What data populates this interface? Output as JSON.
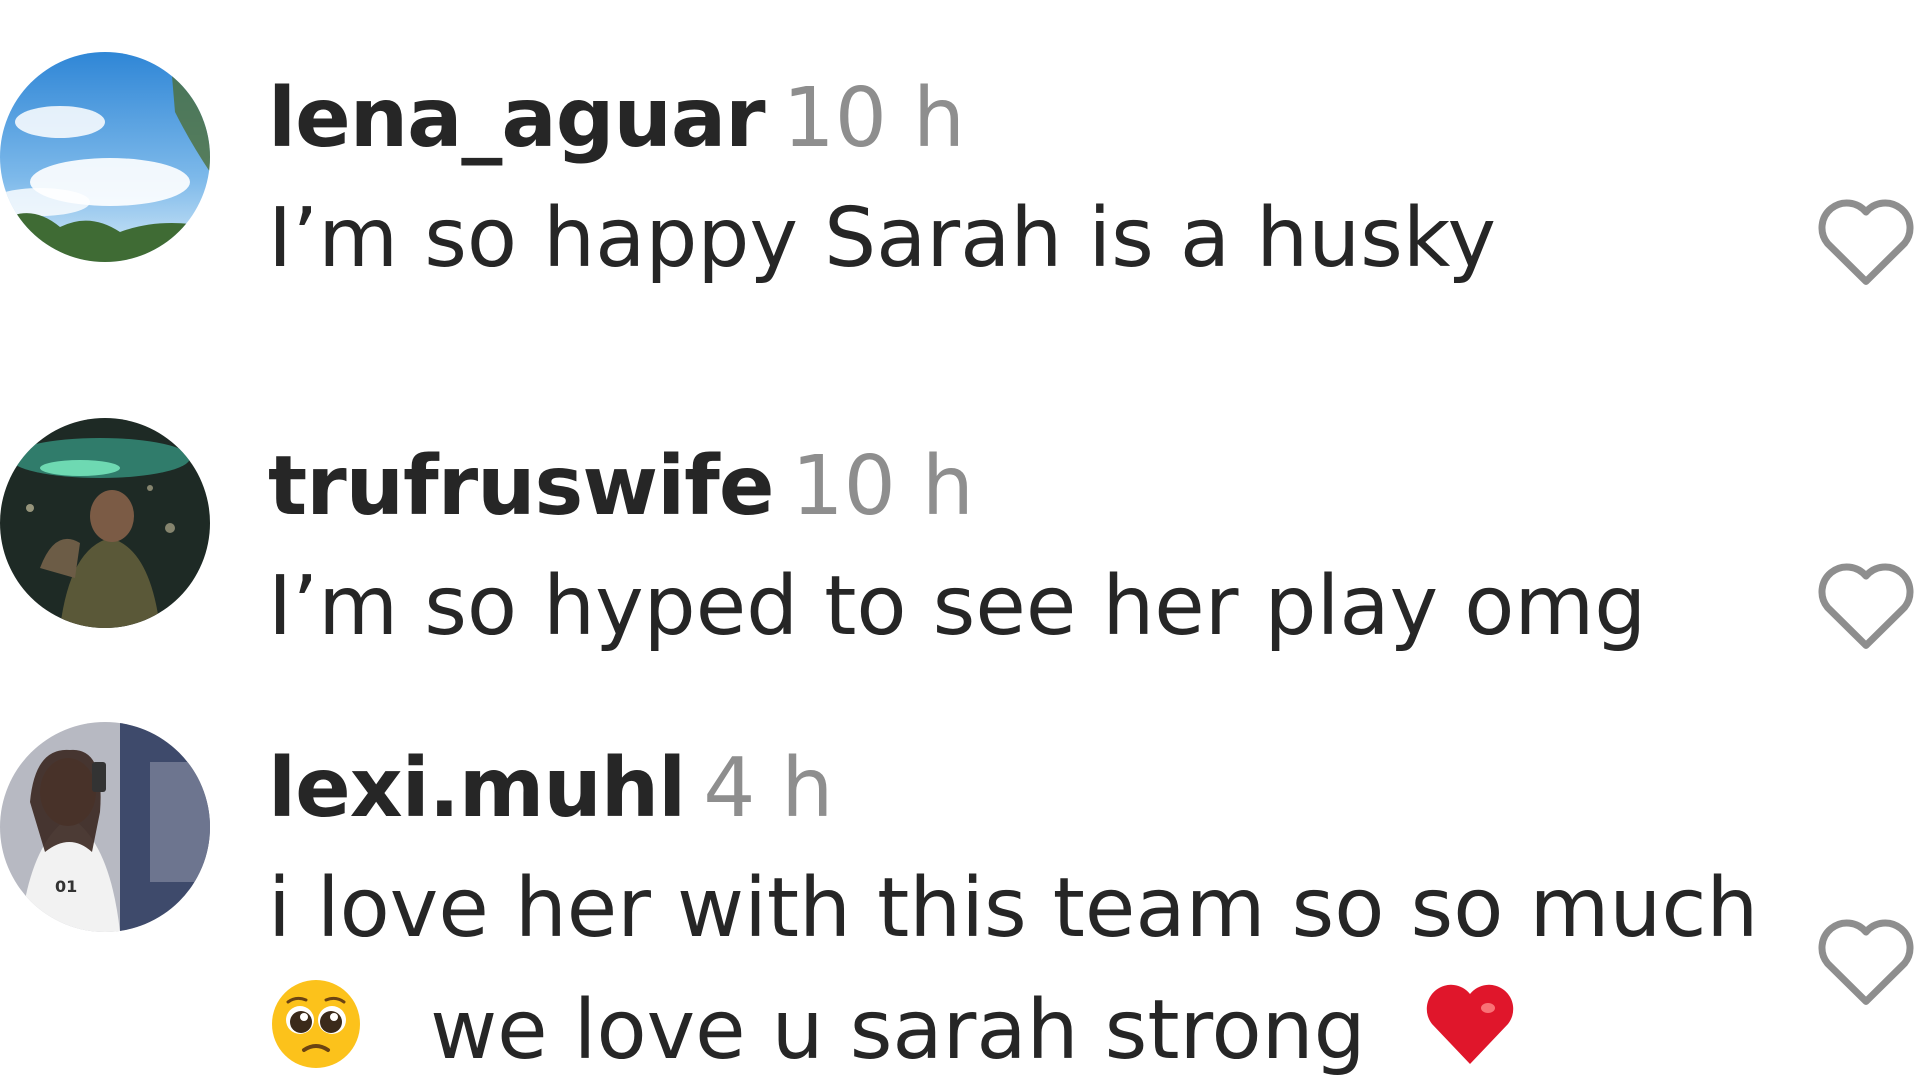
{
  "comments": [
    {
      "username": "lena_aguar",
      "time": "10 h",
      "text": "I’m so happy Sarah is a husky"
    },
    {
      "username": "trufruswife",
      "time": "10 h",
      "text": "I’m so hyped to see her play omg"
    },
    {
      "username": "lexi.muhl",
      "time": "4 h",
      "text_line1": "i love her with this team so so much",
      "text_line2": "we love u sarah strong"
    }
  ],
  "icons": {
    "like": "heart-outline-icon",
    "pleading": "pleading-face-emoji-icon",
    "heart": "red-heart-emoji-icon"
  },
  "colors": {
    "username": "#262626",
    "timestamp": "#8e8e8e",
    "like_outline": "#8e8e8e",
    "heart_emoji": "#e0162b"
  }
}
